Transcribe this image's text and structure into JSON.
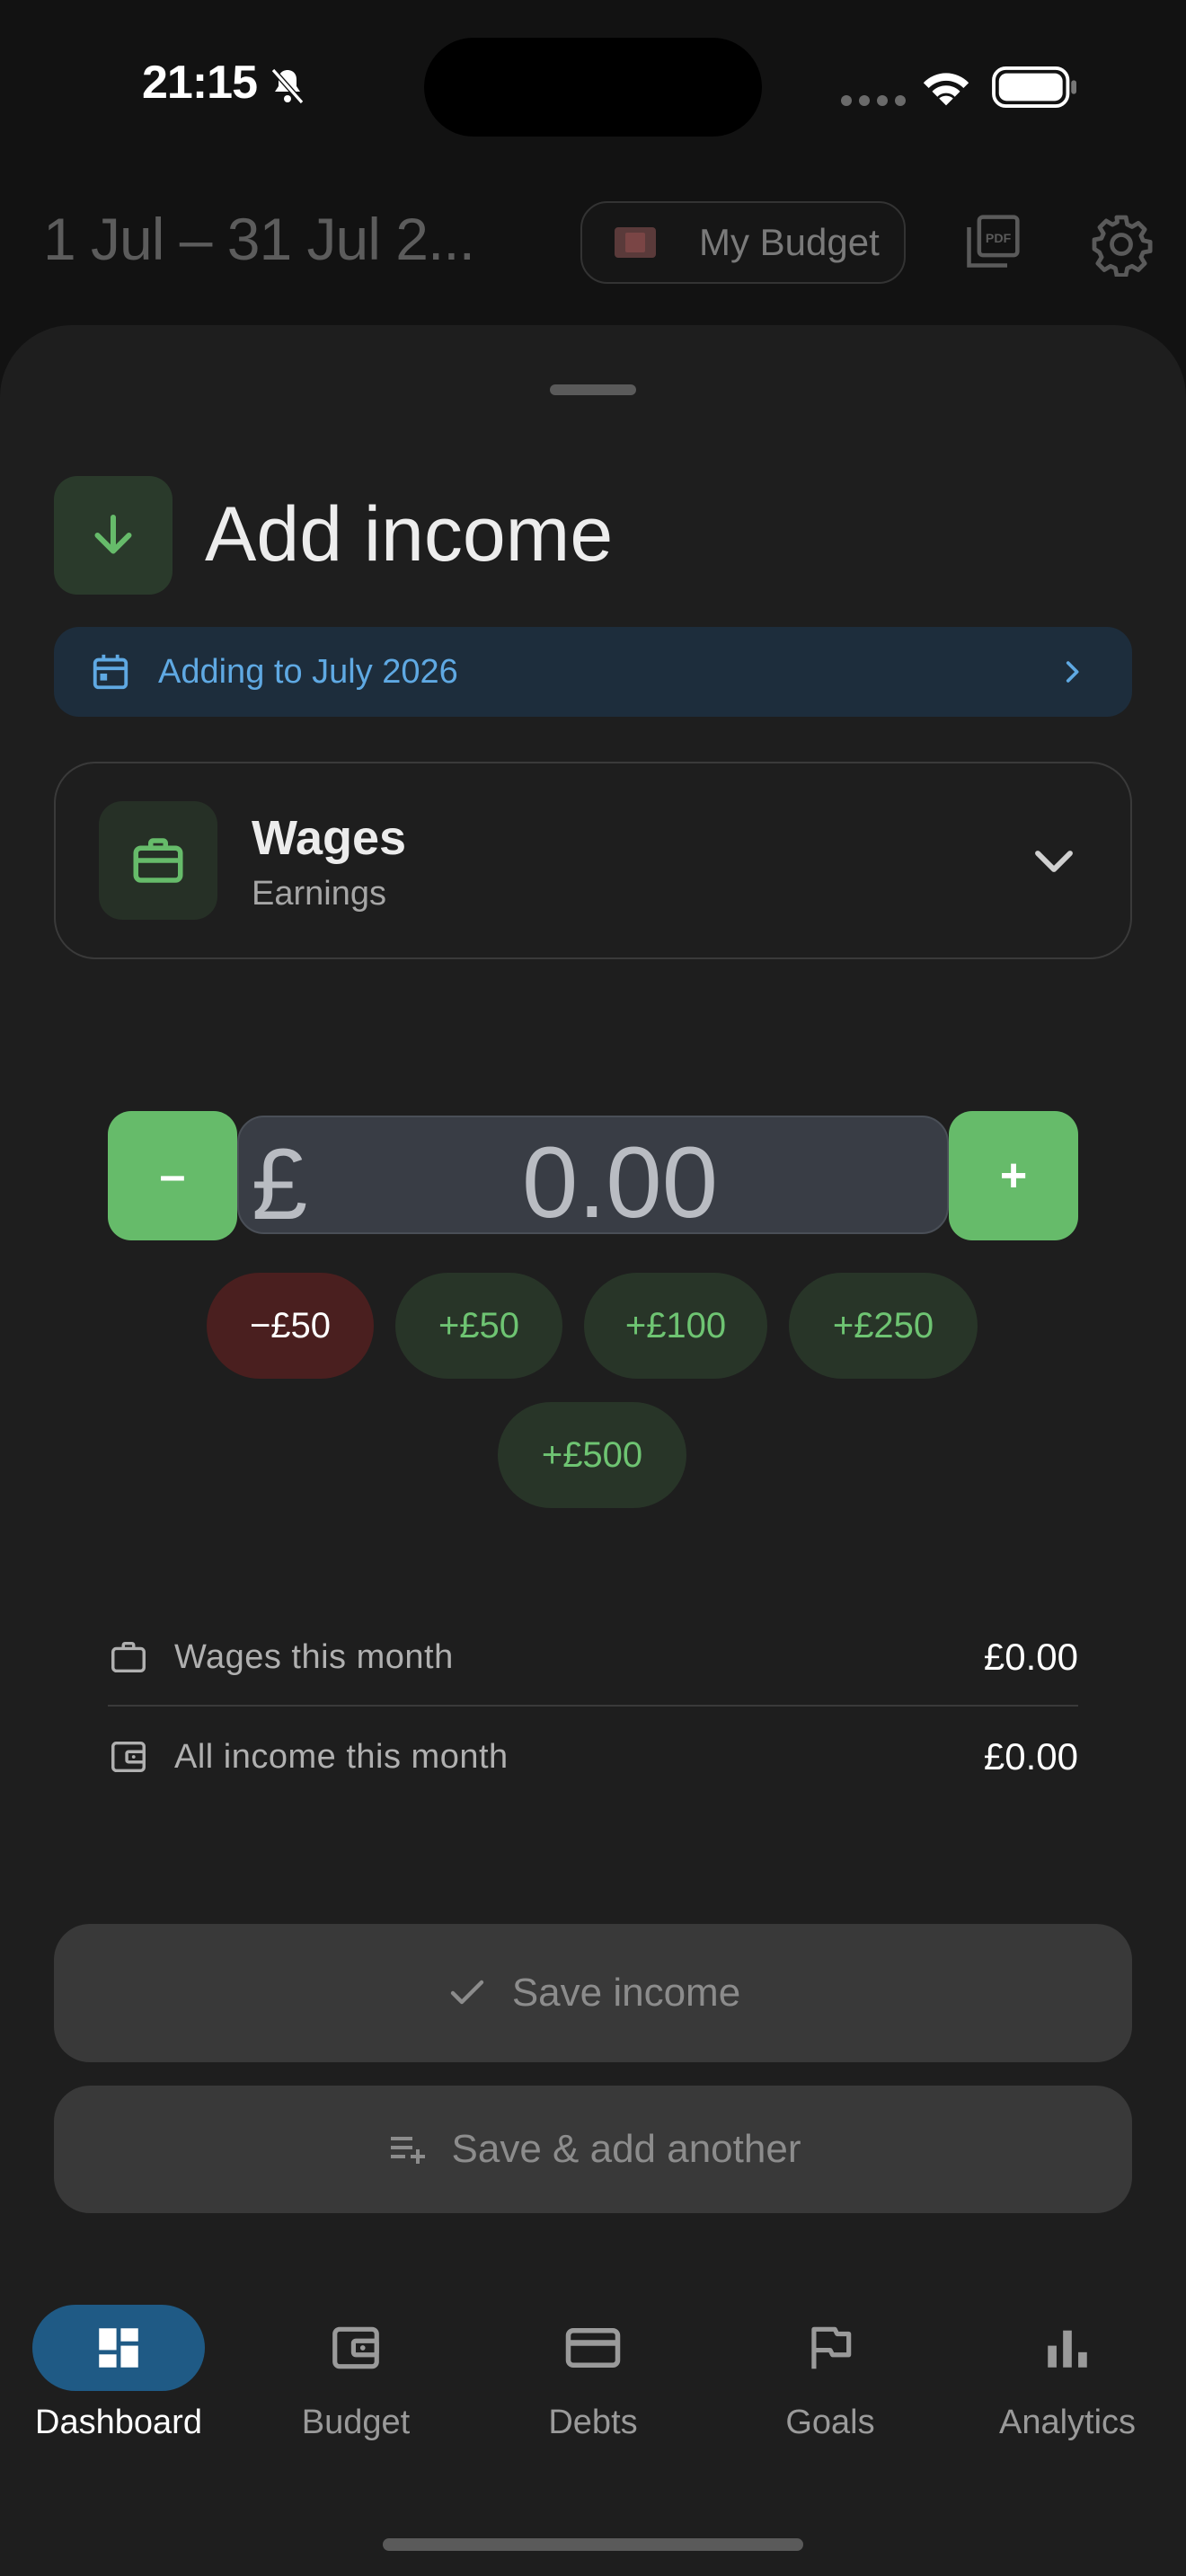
{
  "status": {
    "time": "21:15"
  },
  "header": {
    "date_range": "1 Jul – 31 Jul 2...",
    "budget_name": "My Budget"
  },
  "sheet": {
    "title": "Add income",
    "banner": "Adding to July 2026",
    "category": {
      "name": "Wages",
      "subtitle": "Earnings"
    },
    "amount": {
      "currency": "£",
      "value": "0.00",
      "minus_label": "–",
      "plus_label": "+"
    },
    "quick_chips": [
      "−£50",
      "+£50",
      "+£100",
      "+£250",
      "+£500"
    ],
    "summary": [
      {
        "label": "Wages this month",
        "value": "£0.00",
        "icon": "briefcase-icon"
      },
      {
        "label": "All income this month",
        "value": "£0.00",
        "icon": "wallet-icon"
      }
    ],
    "save_label": "Save income",
    "save_another_label": "Save & add another"
  },
  "nav": {
    "items": [
      {
        "label": "Dashboard",
        "icon": "dashboard-icon",
        "active": true
      },
      {
        "label": "Budget",
        "icon": "wallet-icon",
        "active": false
      },
      {
        "label": "Debts",
        "icon": "credit-card-icon",
        "active": false
      },
      {
        "label": "Goals",
        "icon": "flag-icon",
        "active": false
      },
      {
        "label": "Analytics",
        "icon": "bar-chart-icon",
        "active": false
      }
    ]
  },
  "colors": {
    "accent_green": "#66bb6a",
    "accent_blue": "#5fa9e3",
    "negative": "#4a1f1f",
    "nav_active": "#1f5a85"
  }
}
